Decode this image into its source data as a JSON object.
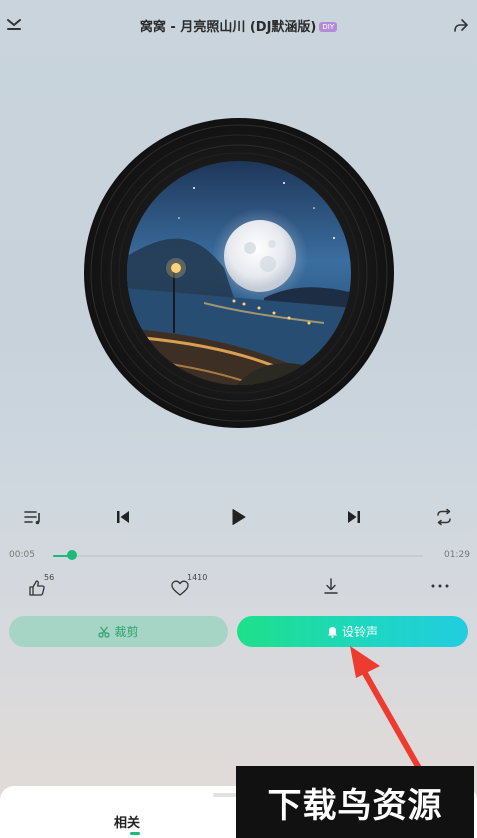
{
  "header": {
    "title": "窝窝 - 月亮照山川 (DJ默涵版)",
    "badge": "DIY",
    "collapse_icon": "chevron-down-icon",
    "share_icon": "share-icon"
  },
  "album_art": {
    "description_icon": "vinyl-record"
  },
  "controls": {
    "playlist_icon": "playlist-icon",
    "previous_icon": "skip-previous-icon",
    "play_icon": "play-icon",
    "next_icon": "skip-next-icon",
    "repeat_icon": "repeat-icon"
  },
  "progress": {
    "current_time": "00:05",
    "total_time": "01:29",
    "fraction": 0.05
  },
  "actions": {
    "like_count": "56",
    "favorite_count": "1410"
  },
  "buttons": {
    "cut_label": "裁剪",
    "ringtone_label": "设铃声"
  },
  "bottom_sheet": {
    "tab_label": "相关"
  },
  "watermark": {
    "text": "下载鸟资源"
  },
  "colors": {
    "accent": "#1db978",
    "ringtone_gradient_start": "#1ee08a",
    "ringtone_gradient_end": "#22cde0",
    "arrow": "#ee3b2f"
  }
}
